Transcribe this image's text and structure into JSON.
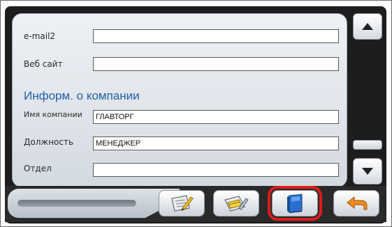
{
  "form": {
    "fields": [
      {
        "label": "e-mail2",
        "value": ""
      },
      {
        "label": "Веб сайт",
        "value": ""
      }
    ],
    "section_title": "Информ. о компании",
    "company_fields": [
      {
        "label": "Имя компании",
        "value": "ГЛАВТОРГ"
      },
      {
        "label": "Должность",
        "value": "МЕНЕДЖЕР"
      },
      {
        "label": "Отдел",
        "value": ""
      }
    ]
  },
  "scrollbar": {
    "up_icon": "triangle-up",
    "down_icon": "triangle-down"
  },
  "toolbar": {
    "buttons": [
      {
        "icon": "edit-note-icon",
        "highlighted": false
      },
      {
        "icon": "edit-list-icon",
        "highlighted": false
      },
      {
        "icon": "book-icon",
        "highlighted": true
      },
      {
        "icon": "back-arrow-icon",
        "highlighted": false
      }
    ]
  },
  "colors": {
    "section_title": "#1f5fa8",
    "highlight": "#e21b1b",
    "arrow": "#f08a1c"
  }
}
